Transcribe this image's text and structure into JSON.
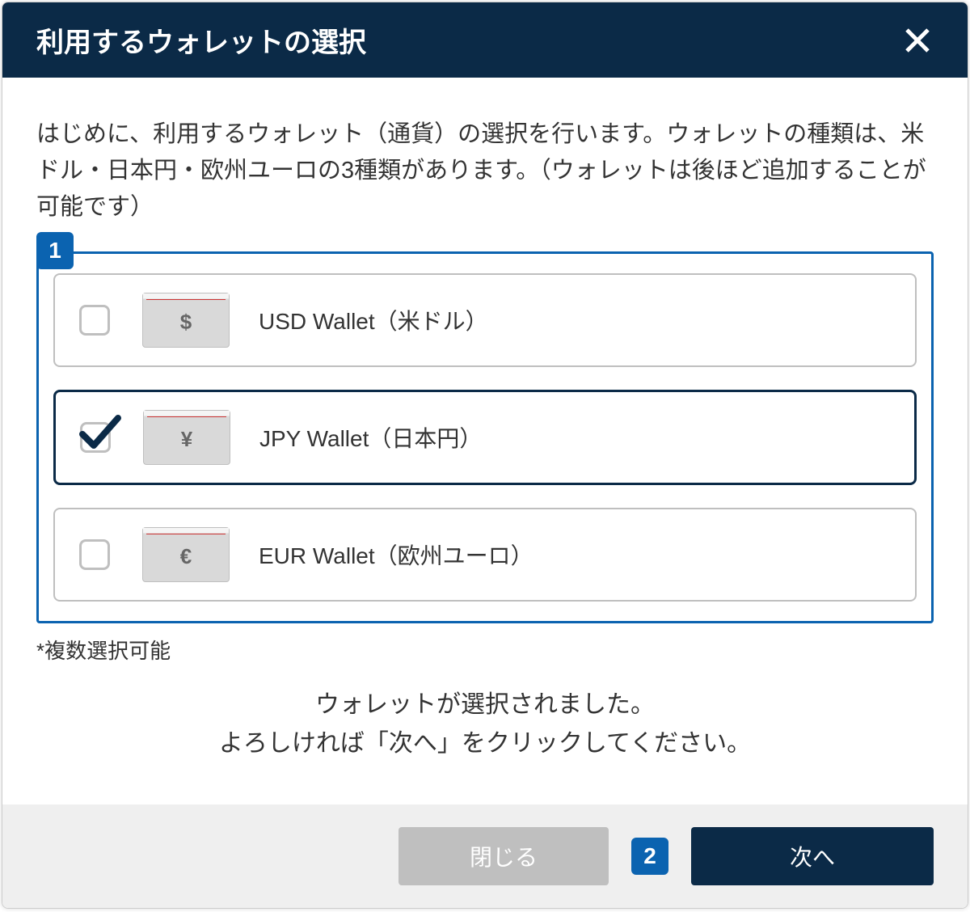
{
  "header": {
    "title": "利用するウォレットの選択"
  },
  "intro": "はじめに、利用するウォレット（通貨）の選択を行います。ウォレットの種類は、米ドル・日本円・欧州ユーロの3種類があります。（ウォレットは後ほど追加することが可能です）",
  "badges": {
    "one": "1",
    "two": "2"
  },
  "wallets": [
    {
      "symbol": "$",
      "label": "USD Wallet（米ドル）",
      "checked": false
    },
    {
      "symbol": "¥",
      "label": "JPY Wallet（日本円）",
      "checked": true
    },
    {
      "symbol": "€",
      "label": "EUR Wallet（欧州ユーロ）",
      "checked": false
    }
  ],
  "footnote": "*複数選択可能",
  "status": {
    "line1": "ウォレットが選択されました。",
    "line2": "よろしければ「次へ」をクリックしてください。"
  },
  "footer": {
    "close": "閉じる",
    "next": "次へ"
  }
}
